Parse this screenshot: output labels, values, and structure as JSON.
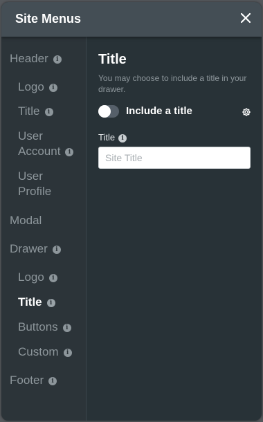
{
  "modal": {
    "title": "Site Menus",
    "close_icon": "close-icon"
  },
  "sidebar": {
    "items": [
      {
        "label": "Header",
        "level": 0,
        "info": true,
        "active": false
      },
      {
        "label": "Logo",
        "level": 1,
        "info": true,
        "active": false
      },
      {
        "label": "Title",
        "level": 1,
        "info": true,
        "active": false
      },
      {
        "label": "User Account",
        "level": 1,
        "info": true,
        "active": false
      },
      {
        "label": "User Profile",
        "level": 1,
        "info": false,
        "active": false
      },
      {
        "label": "Modal",
        "level": 0,
        "info": false,
        "active": false
      },
      {
        "label": "Drawer",
        "level": 0,
        "info": true,
        "active": false
      },
      {
        "label": "Logo",
        "level": 1,
        "info": true,
        "active": false
      },
      {
        "label": "Title",
        "level": 1,
        "info": true,
        "active": true
      },
      {
        "label": "Buttons",
        "level": 1,
        "info": true,
        "active": false
      },
      {
        "label": "Custom",
        "level": 1,
        "info": true,
        "active": false
      },
      {
        "label": "Footer",
        "level": 0,
        "info": true,
        "active": false
      }
    ]
  },
  "main": {
    "title": "Title",
    "description": "You may choose to include a title in your drawer.",
    "toggle": {
      "label": "Include a title",
      "on": false
    },
    "settings_icon": "gear-icon",
    "field": {
      "label": "Title",
      "value": "",
      "placeholder": "Site Title"
    }
  },
  "info_glyph": "i",
  "colors": {
    "header_bg": "#444e55",
    "panel_bg": "#283237",
    "sidebar_bg": "#2c3439",
    "muted_text": "#8d969b",
    "active_text": "#ffffff"
  }
}
